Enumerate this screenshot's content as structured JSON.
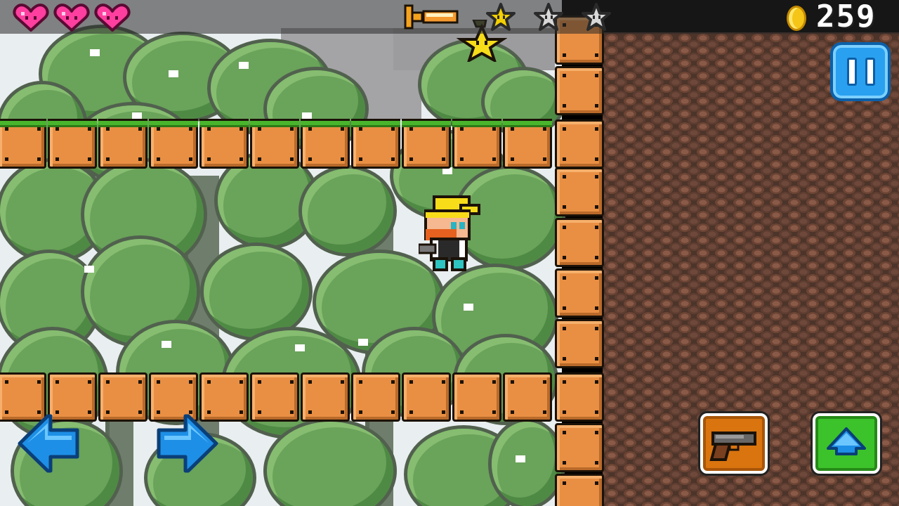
{
  "hud": {
    "lives": 3,
    "coin_count": "259",
    "stars": [
      {
        "state": "collected",
        "color": "#f5d000"
      },
      {
        "state": "empty",
        "color": "#d8d8d8"
      },
      {
        "state": "empty",
        "color": "#d8d8d8"
      }
    ],
    "weapon_icon": "sword-icon",
    "heart_color": "#ff3f9f",
    "coin_color": "#f5c518"
  },
  "controls": {
    "pause_icon": "pause-icon",
    "left_icon": "arrow-left-icon",
    "right_icon": "arrow-right-icon",
    "shoot_icon": "pistol-icon",
    "jump_icon": "arrow-up-icon"
  },
  "colors": {
    "block": "#e98f43",
    "grass": "#49b52c",
    "wall": "#4c342a",
    "pause_blue": "#2aa0f0",
    "shoot_orange": "#d9740f",
    "jump_green": "#3cc22a",
    "dpad_blue": "#1e8fe6"
  }
}
